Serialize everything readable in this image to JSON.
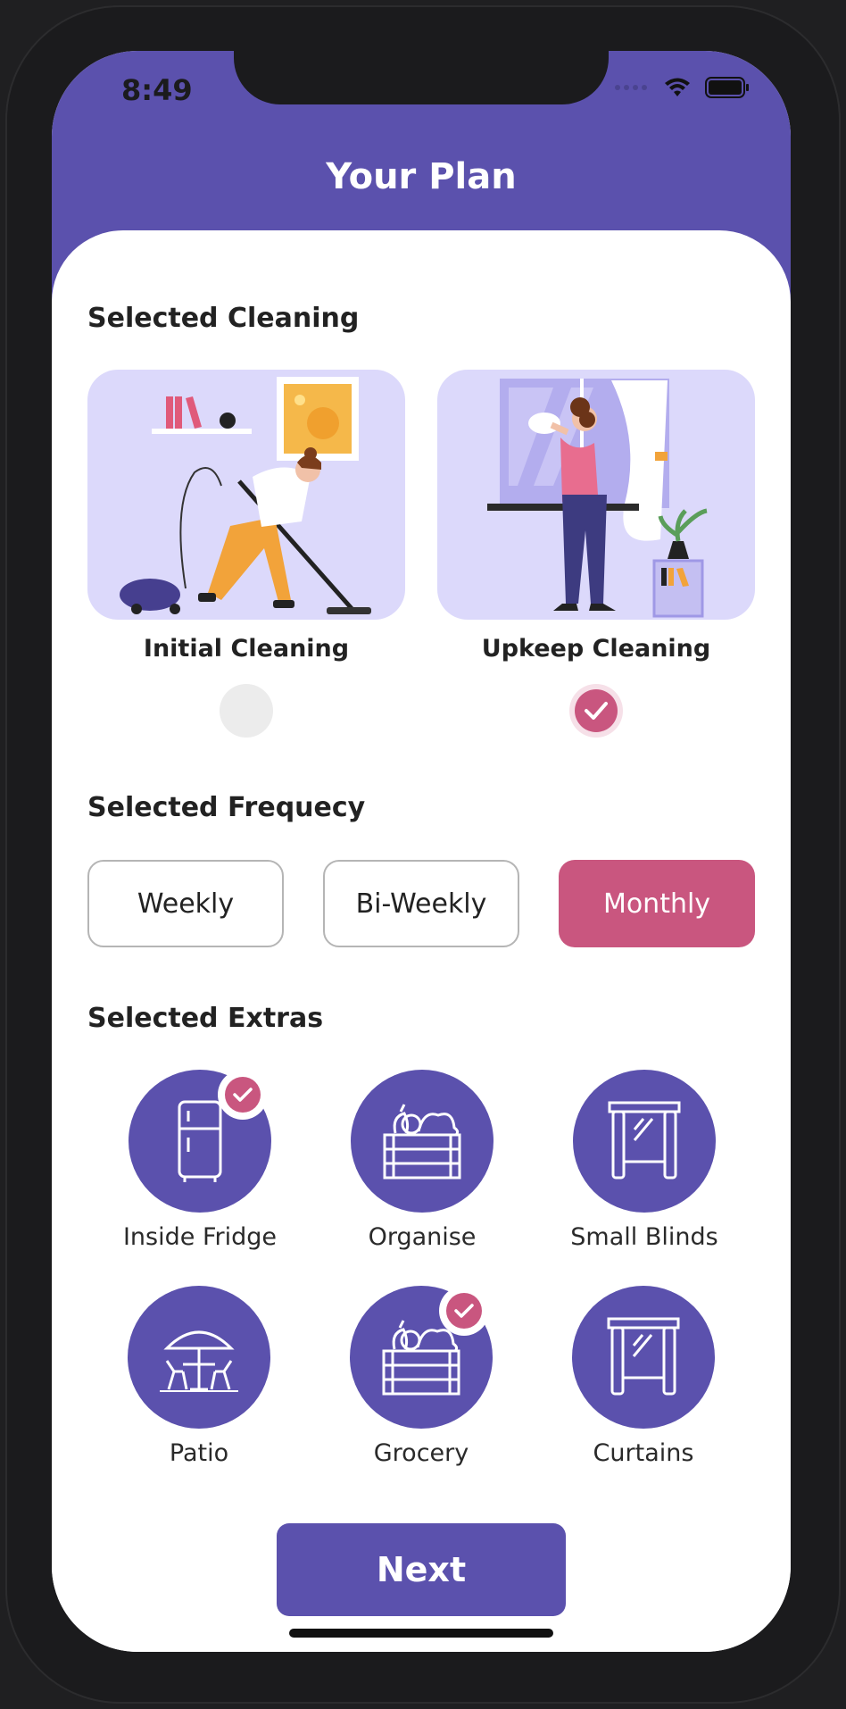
{
  "status_bar": {
    "time": "8:49"
  },
  "header": {
    "title": "Your Plan"
  },
  "sections": {
    "cleaning": "Selected Cleaning",
    "frequency": "Selected Frequecy",
    "extras": "Selected Extras"
  },
  "cleaning_options": [
    {
      "label": "Initial Cleaning",
      "selected": false
    },
    {
      "label": "Upkeep Cleaning",
      "selected": true
    }
  ],
  "frequency_options": [
    {
      "label": "Weekly",
      "selected": false
    },
    {
      "label": "Bi-Weekly",
      "selected": false
    },
    {
      "label": "Monthly",
      "selected": true
    }
  ],
  "extras": [
    {
      "label": "Inside Fridge",
      "icon": "fridge-icon",
      "selected": true
    },
    {
      "label": "Organise",
      "icon": "crate-icon",
      "selected": false
    },
    {
      "label": "Small Blinds",
      "icon": "window-icon",
      "selected": false
    },
    {
      "label": "Patio",
      "icon": "patio-icon",
      "selected": false
    },
    {
      "label": "Grocery",
      "icon": "crate-icon",
      "selected": true
    },
    {
      "label": "Curtains",
      "icon": "window-icon",
      "selected": false
    }
  ],
  "next_button": "Next",
  "colors": {
    "primary": "#5b51ad",
    "accent": "#c9567f",
    "card_bg": "#dcd9fb"
  }
}
